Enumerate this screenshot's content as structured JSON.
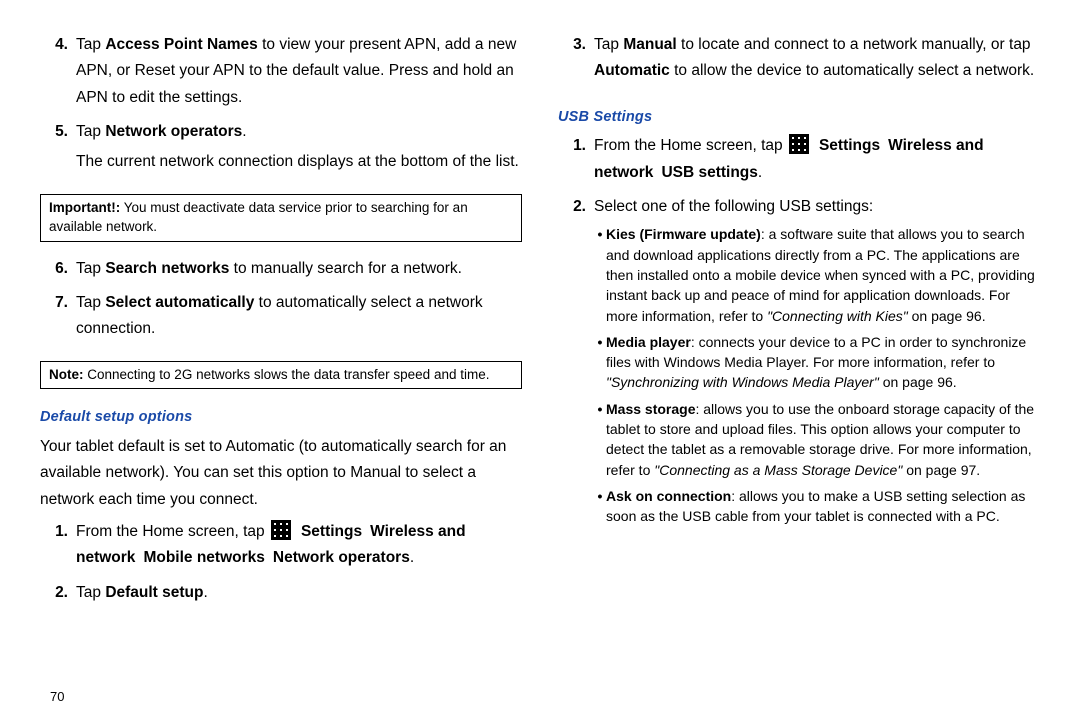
{
  "page_number": "70",
  "left": {
    "item4": {
      "num": "4.",
      "pre": "Tap ",
      "b": "Access Point Names",
      "post": " to view your present APN, add a new APN, or Reset your APN to the default value. Press and hold an APN to edit the settings."
    },
    "item5": {
      "num": "5.",
      "pre": "Tap ",
      "b": "Network operators",
      "post": ".",
      "line2": "The current network connection displays at the bottom of the list."
    },
    "important": {
      "label": "Important!:",
      "text": " You must deactivate data service prior to searching for an available network."
    },
    "item6": {
      "num": "6.",
      "pre": "Tap ",
      "b": "Search networks",
      "post": " to manually search for a network."
    },
    "item7": {
      "num": "7.",
      "pre": "Tap ",
      "b": "Select automatically",
      "post": " to automatically select a network connection."
    },
    "note": {
      "label": "Note:",
      "text": " Connecting to 2G networks slows the data transfer speed and time."
    },
    "sect1_head": "Default setup options",
    "sect1_body": "Your tablet default is set to Automatic (to automatically search for an available network). You can set this option to Manual to select a network each time you connect.",
    "sect1_item1": {
      "num": "1.",
      "pre": "From the Home screen, tap ",
      "path": [
        "Settings",
        "Wireless and network",
        "Mobile networks",
        "Network operators"
      ],
      "post": "."
    },
    "sect1_item2": {
      "num": "2.",
      "pre": "Tap ",
      "b": "Default setup",
      "post": "."
    }
  },
  "right": {
    "item3": {
      "num": "3.",
      "pre": "Tap ",
      "b1": "Manual",
      "mid": " to locate and connect to a network manually, or tap ",
      "b2": "Automatic",
      "post": " to allow the device to automatically select a network."
    },
    "sect_head": "USB Settings",
    "item1": {
      "num": "1.",
      "pre": "From the Home screen, tap ",
      "path": [
        "Settings",
        "Wireless and network",
        "USB settings"
      ],
      "post": "."
    },
    "item2": {
      "num": "2.",
      "text": "Select one of the following USB settings:"
    },
    "bullets": [
      {
        "b": "Kies (Firmware update)",
        "txt": ": a software suite that allows you to search and download applications directly from a PC. The applications are then installed onto a mobile device when synced with a PC, providing instant back up and peace of mind for application downloads. For more information, refer to ",
        "ref": "\"Connecting with Kies\"",
        "pg": "  on page 96."
      },
      {
        "b": "Media player",
        "txt": ": connects your device to a PC in order to synchronize files with Windows Media Player. For more information, refer to ",
        "ref": "\"Synchronizing with Windows Media Player\"",
        "pg": "  on page 96."
      },
      {
        "b": "Mass storage",
        "txt": ": allows you to use the onboard storage capacity of the tablet to store and upload files. This option allows your computer to detect the tablet as a removable storage drive. For more information, refer to ",
        "ref": "\"Connecting as a Mass Storage Device\"",
        "pg": "  on page 97."
      },
      {
        "b": "Ask on connection",
        "txt": ": allows you to make a USB setting selection as soon as the USB cable from your tablet is connected with a PC.",
        "ref": "",
        "pg": ""
      }
    ]
  }
}
